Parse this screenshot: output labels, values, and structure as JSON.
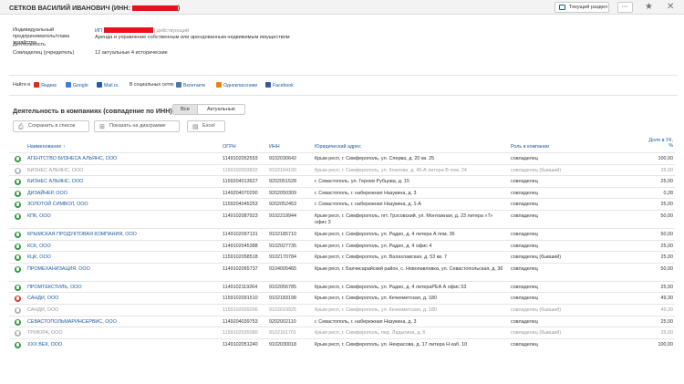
{
  "header": {
    "person": "СЕТКОВ ВАСИЛИЙ ИВАНОВИЧ",
    "inn_prefix": "(ИНН:",
    "inn_suffix": ")",
    "section_button": "Текущий раздел",
    "more_button": "···",
    "star_icon": "★",
    "close_icon": "✕"
  },
  "info": {
    "ip_label": "Индивидуальный предприниматель/глава хозяйства",
    "ip_prefix": "ИП",
    "ip_status": "действующий",
    "activity_label": "Деятельность",
    "activity_value": "Аренда и управление собственным или арендованным недвижимым имуществом",
    "cofounder_label": "Совладелец (учредитель)",
    "cofounder_value": "12 актуальные 4 исторические"
  },
  "find": {
    "label": "Найти в",
    "yandex": "Яндекс",
    "google": "Google",
    "mail": "Mail.ru",
    "social": "В социальных сетях",
    "vk": "Вконтакте",
    "ok": "Одноклассники",
    "fb": "Facebook"
  },
  "section": {
    "title": "Деятельность в компаниях (совпадение по ИНН)",
    "toggle_all": "Все",
    "toggle_actual": "Актуальные",
    "btn_save": "Сохранить в список",
    "btn_diagram": "Показать на диаграмме",
    "btn_excel": "Excel"
  },
  "columns": {
    "name": "Наименование ↑",
    "ogrn": "ОГРН",
    "inn": "ИНН",
    "address": "Юридический адрес",
    "role": "Роль в компании",
    "share_1": "Доля в УК,",
    "share_2": "%"
  },
  "rows": [
    {
      "status": "g",
      "inactive": false,
      "name": "АГЕНТСТВО БИЗНЕСА АЛЬЯНС, ООО",
      "ogrn": "1149102052593",
      "inn": "9102030642",
      "address": "Крым респ, г. Симферополь, ул. Сперва, д. 20 кв. 25",
      "role": "совладелец",
      "share": "100,00"
    },
    {
      "status": "x",
      "inactive": true,
      "name": "БИЗНЕС АЛЬЯНС, ООО",
      "ogrn": "1159102003832",
      "inn": "9102164100",
      "address": "Крым респ, г. Симферополь, ул. Козлова, д. 45-А литера В пом. 24",
      "role": "совладелец (бывший)",
      "share": "25,00"
    },
    {
      "status": "g",
      "inactive": false,
      "name": "БИЗНЕС АЛЬЯНС, ООО",
      "ogrn": "1159204013627",
      "inn": "9202051528",
      "address": "г. Севастополь, ул. Героев Рубцова, д. 15",
      "role": "совладелец",
      "share": "25,00"
    },
    {
      "status": "g",
      "inactive": false,
      "name": "ДИЗАЙНЕР, ООО",
      "ogrn": "1149204070290",
      "inn": "9202050309",
      "address": "г. Севастополь, г. набережная Назукина, д. 3",
      "role": "совладелец",
      "share": "0,28"
    },
    {
      "status": "g",
      "inactive": false,
      "name": "ЗОЛОТОЙ СИМВОЛ, ООО",
      "ogrn": "1159204045253",
      "inn": "9202052453",
      "address": "г. Севастополь, г. набережная Назукина, д. 1-А",
      "role": "совладелец",
      "share": "25,00"
    },
    {
      "status": "g",
      "inactive": false,
      "name": "КПК, ООО",
      "ogrn": "1149102087923",
      "inn": "9102219944",
      "address": "Крым респ, г. Симферополь, пгт. Грэсовский, ул. Монтажная, д. 23 литера «Т» офис 3",
      "role": "совладелец",
      "share": "50,00"
    },
    {
      "status": "g",
      "inactive": false,
      "name": "КРЫМСКАЯ ПРОДУКТОВАЯ КОМПАНИЯ, ООО",
      "ogrn": "1149102097131",
      "inn": "9102185710",
      "address": "Крым респ, г. Симферополь, ул. Радио, д. 4 литера А пом. 36",
      "role": "совладелец",
      "share": "50,00"
    },
    {
      "status": "g",
      "inactive": false,
      "name": "КСК, ООО",
      "ogrn": "1149102045388",
      "inn": "9102027735",
      "address": "Крым респ, г. Симферополь, ул. Радио, д. 4 офис 4",
      "role": "совладелец",
      "share": "25,00"
    },
    {
      "status": "g",
      "inactive": false,
      "name": "КЦК, ООО",
      "ogrn": "1159102058518",
      "inn": "9102170784",
      "address": "Крым респ, г. Симферополь, ул. Валахлавская, д. 53 кв. 7",
      "role": "совладелец (бывший)",
      "share": "25,00"
    },
    {
      "status": "g",
      "inactive": false,
      "name": "ПРОМЕХАНИЗАЦИЯ, ООО",
      "ogrn": "1149102065737",
      "inn": "9104005465",
      "address": "Крым респ, г. Бахчисарайский район, с. Новопавловка, ул. Севастопольская, д. 36",
      "role": "совладелец",
      "share": "50,00"
    },
    {
      "status": "g",
      "inactive": false,
      "name": "ПРОМТЕКСТИЛЬ, ООО",
      "ogrn": "1149102119264",
      "inn": "9102056785",
      "address": "Крым респ, г. Симферополь, ул. Радио, д. 4 литераРЕА А офис 53",
      "role": "совладелец",
      "share": "25,00"
    },
    {
      "status": "r",
      "inactive": false,
      "name": "САНДИ, ООО",
      "ogrn": "1159102091510",
      "inn": "9102183198",
      "address": "Крым респ, г. Симферополь, ул. Кечкеметская, д. 180",
      "role": "совладелец",
      "share": "49,30"
    },
    {
      "status": "x",
      "inactive": true,
      "name": "САНДИ, ООО",
      "ogrn": "1159102009206",
      "inn": "9102019925",
      "address": "Крым респ, г. Симферополь, ул. Кечкеметская, д. 180",
      "role": "совладелец (бывший)",
      "share": "49,30"
    },
    {
      "status": "g",
      "inactive": false,
      "name": "СЕВАСТОПОЛЬМАРИНСЕРВИС, ООО",
      "ogrn": "1149204039753",
      "inn": "9202002110",
      "address": "г. Севастополь, г. набережная Назукина, д. 3",
      "role": "совладелец",
      "share": "25,00"
    },
    {
      "status": "x",
      "inactive": true,
      "name": "ТРИЮРА, ООО",
      "ogrn": "1159102035080",
      "inn": "9102161701",
      "address": "Крым респ, г. Симферополь, пер. Ладыгина, д. 6",
      "role": "совладелец (бывший)",
      "share": "25,00"
    },
    {
      "status": "g",
      "inactive": false,
      "name": "XXX ВЕК, ООО",
      "ogrn": "1149102051240",
      "inn": "9102030018",
      "address": "Крым респ, г. Симферополь, ул. Некрасова, д. 17 литера Н каб. 10",
      "role": "совладелец",
      "share": "100,00"
    }
  ]
}
